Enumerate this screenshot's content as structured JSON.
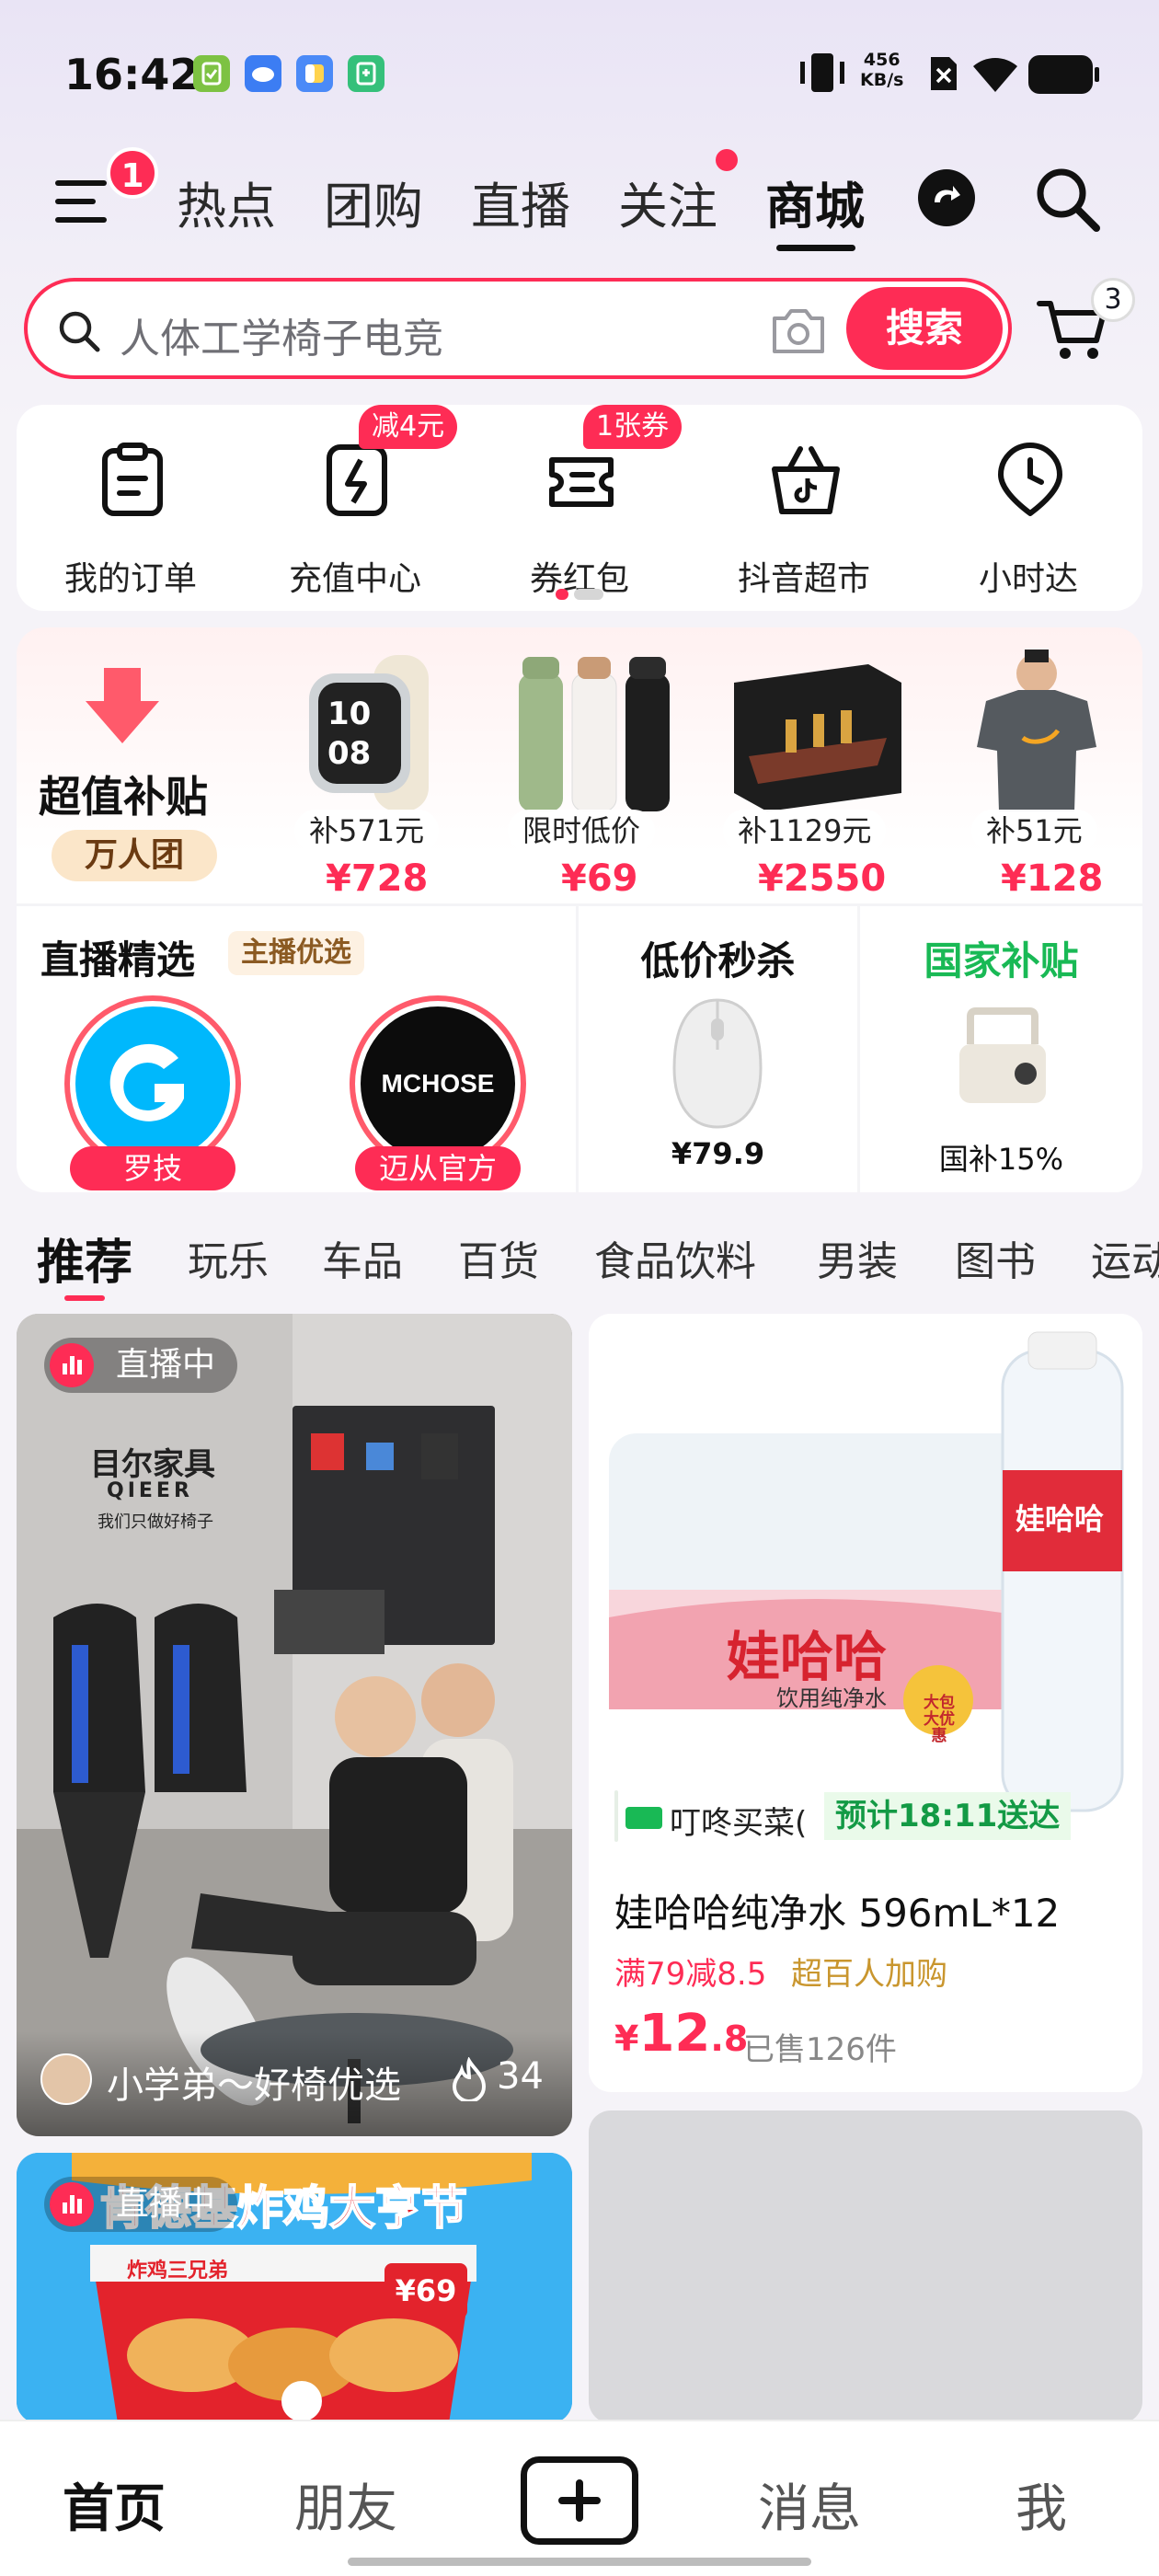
{
  "status_bar": {
    "time": "16:42",
    "net_speed_value": "456",
    "net_speed_unit": "KB/s",
    "battery": "full",
    "notif_icons": [
      "task-app-icon",
      "cloud-app-icon",
      "files-app-icon",
      "health-app-icon"
    ]
  },
  "top_nav": {
    "menu_badge": "1",
    "tabs": [
      "热点",
      "团购",
      "直播",
      "关注",
      "商城"
    ],
    "active_tab": "商城"
  },
  "search": {
    "placeholder": "人体工学椅子电竞",
    "button_label": "搜索",
    "cart_count": "3"
  },
  "shortcuts": [
    {
      "label": "我的订单",
      "icon": "order-icon",
      "badge": ""
    },
    {
      "label": "充值中心",
      "icon": "recharge-icon",
      "badge": "减4元"
    },
    {
      "label": "券红包",
      "icon": "coupon-icon",
      "badge": "1张券"
    },
    {
      "label": "抖音超市",
      "icon": "supermarket-icon",
      "badge": ""
    },
    {
      "label": "小时达",
      "icon": "hour-delivery-icon",
      "badge": ""
    }
  ],
  "subsidy": {
    "title": "超值补贴",
    "subtitle": "万人团",
    "products": [
      {
        "tag": "补571元",
        "price_symbol": "¥",
        "price": "728",
        "name": "smart-watch"
      },
      {
        "tag": "限时低价",
        "price_symbol": "¥",
        "price": "69",
        "name": "thermos-bottles"
      },
      {
        "tag": "补1129元",
        "price_symbol": "¥",
        "price": "2550",
        "name": "lego-ship"
      },
      {
        "tag": "补51元",
        "price_symbol": "¥",
        "price": "128",
        "name": "nike-tshirt"
      }
    ]
  },
  "live_select": {
    "title": "直播精选",
    "tag": "主播优选",
    "anchors": [
      {
        "label": "罗技",
        "logo_text": "G"
      },
      {
        "label": "迈从官方",
        "logo_text": "MCHOSE"
      }
    ]
  },
  "flash_sale": {
    "title": "低价秒杀",
    "price": "¥79.9"
  },
  "national_subsidy": {
    "title": "国家补贴",
    "tag": "国补15%"
  },
  "category_tabs": [
    "推荐",
    "玩乐",
    "车品",
    "百货",
    "食品饮料",
    "男装",
    "图书",
    "运动"
  ],
  "feed": {
    "live_card": {
      "live_label": "直播中",
      "streamer": "小学弟～好椅优选",
      "likes": "34",
      "wall_text_1": "目尔家具",
      "wall_text_2": "QIEER",
      "wall_text_3": "我们只做好椅子"
    },
    "product_card": {
      "brand": "娃哈哈",
      "brand_sub": "饮用纯净水",
      "badge": "大包大优惠",
      "delivery_store": "叮咚买菜(",
      "delivery_eta": "预计18:11送达",
      "title": "娃哈哈纯净水 596mL*12",
      "promo": "满79减8.5",
      "promo2": "超百人加购",
      "price_symbol": "¥",
      "price_int": "12",
      "price_dec": ".8",
      "sold": "已售126件"
    },
    "live_card_2": {
      "live_label": "直播中",
      "banner_title": "肯德基炸鸡大亨节",
      "banner_sub": "炸鸡三兄弟",
      "banner_price": "¥69"
    }
  },
  "bottom_bar": {
    "items": [
      "首页",
      "朋友",
      "消息",
      "我"
    ],
    "active": "首页",
    "add_label": "+"
  },
  "colors": {
    "accent": "#fe2c55",
    "national_green": "#19b955",
    "price_red": "#fe2c55"
  }
}
